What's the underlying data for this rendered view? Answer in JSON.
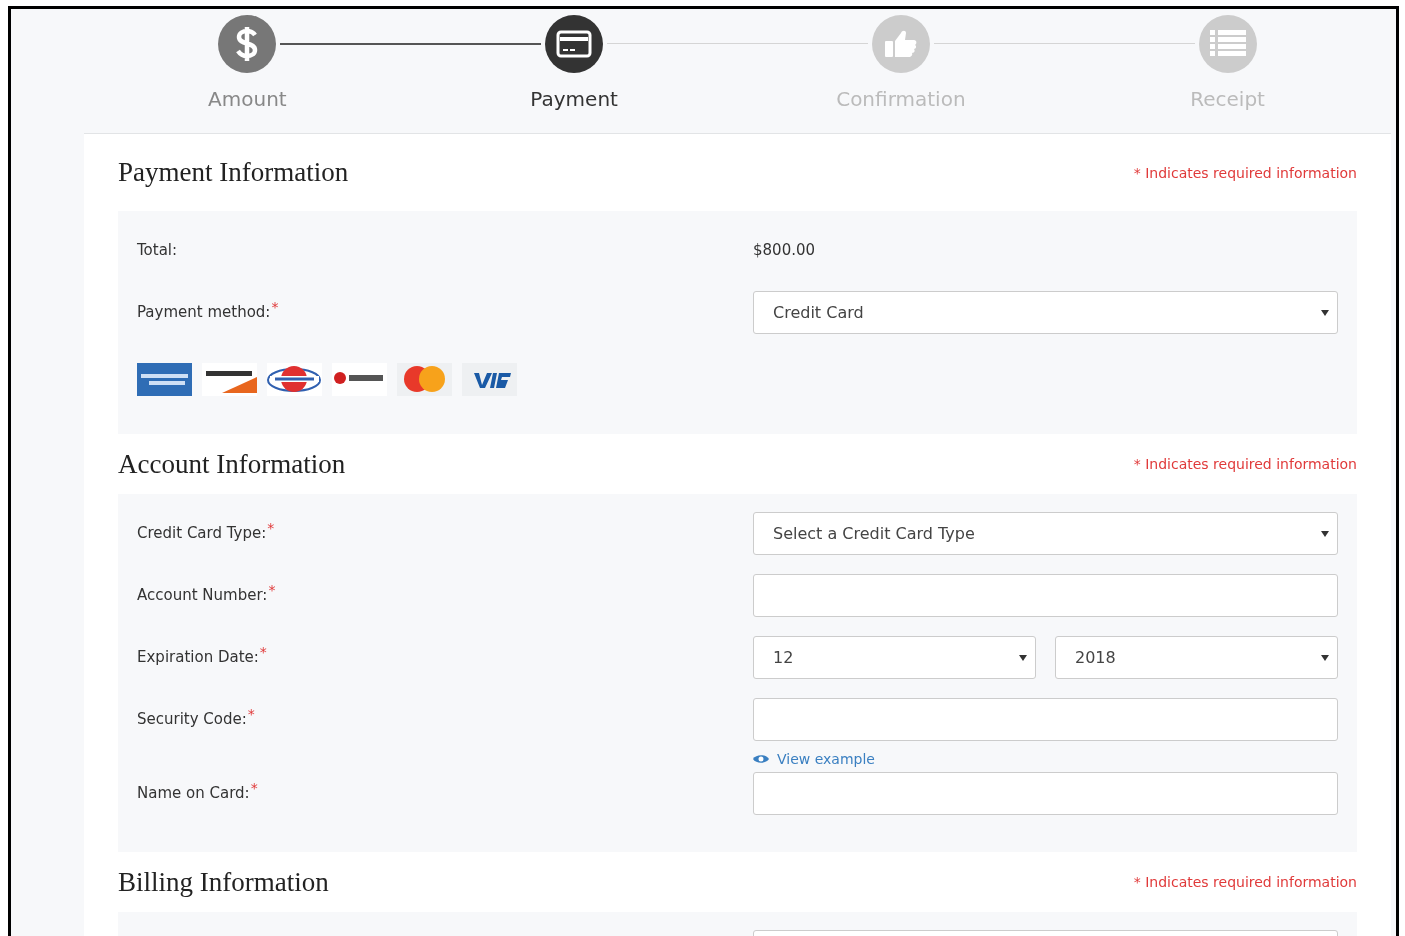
{
  "steps": [
    {
      "label": "Amount",
      "done": true,
      "selected": false,
      "kind": "dollar"
    },
    {
      "label": "Payment",
      "done": false,
      "selected": true,
      "kind": "card"
    },
    {
      "label": "Confirmation",
      "done": false,
      "selected": false,
      "kind": "thumb"
    },
    {
      "label": "Receipt",
      "done": false,
      "selected": false,
      "kind": "list"
    }
  ],
  "sections": [
    {
      "title": "Payment Information",
      "note": "* Indicates required information",
      "rows": [
        {
          "kind": "text",
          "label": "Total:",
          "value": "$800.00"
        },
        {
          "kind": "select",
          "label": "Payment method:",
          "mark": "*",
          "value": "Credit Card"
        },
        {
          "kind": "logos"
        }
      ]
    },
    {
      "title": "Account Information",
      "note": "* Indicates required information",
      "rows": [
        {
          "kind": "select",
          "label": "Credit Card Type:",
          "mark": "*",
          "value": "Select a Credit Card Type"
        },
        {
          "kind": "input",
          "label": "Account Number:",
          "mark": "*"
        },
        {
          "kind": "date",
          "label": "Expiration Date:",
          "mark": "*",
          "month": "12",
          "year": "2018"
        },
        {
          "kind": "input",
          "label": "Security Code:",
          "mark": "*",
          "link": "View example"
        },
        {
          "kind": "input",
          "label": "Name on Card:",
          "mark": "*"
        }
      ]
    },
    {
      "title": "Billing Information",
      "note": "* Indicates required information",
      "rows": [
        {
          "kind": "cut"
        }
      ]
    }
  ]
}
